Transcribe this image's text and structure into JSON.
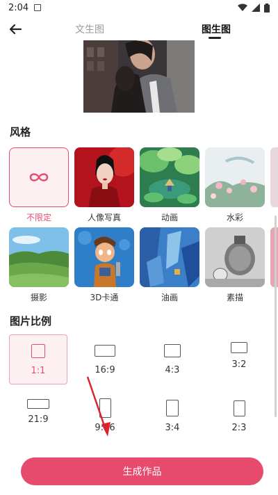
{
  "status_bar": {
    "time": "2:04"
  },
  "header": {
    "tabs": [
      {
        "label": "文生图",
        "active": false
      },
      {
        "label": "图生图",
        "active": true
      }
    ]
  },
  "style_section": {
    "title": "风格",
    "items": [
      {
        "label": "不限定",
        "icon": "infinity-icon",
        "selected": true
      },
      {
        "label": "人像写真",
        "selected": false
      },
      {
        "label": "动画",
        "selected": false
      },
      {
        "label": "水彩",
        "selected": false
      },
      {
        "label": "摄影",
        "selected": false
      },
      {
        "label": "3D卡通",
        "selected": false
      },
      {
        "label": "油画",
        "selected": false
      },
      {
        "label": "素描",
        "selected": false
      }
    ]
  },
  "ratio_section": {
    "title": "图片比例",
    "items": [
      {
        "label": "1:1",
        "selected": true
      },
      {
        "label": "16:9",
        "selected": false
      },
      {
        "label": "4:3",
        "selected": false
      },
      {
        "label": "3:2",
        "selected": false
      },
      {
        "label": "21:9",
        "selected": false
      },
      {
        "label": "9:16",
        "selected": false
      },
      {
        "label": "3:4",
        "selected": false
      },
      {
        "label": "2:3",
        "selected": false
      }
    ]
  },
  "generate_button": {
    "label": "生成作品"
  },
  "colors": {
    "accent": "#e64b6e",
    "accent_light": "#fdf0f3"
  }
}
